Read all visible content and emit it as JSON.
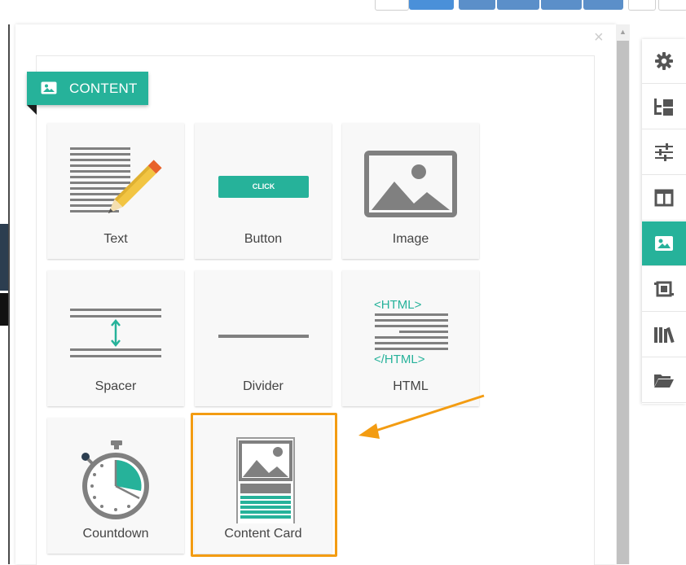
{
  "panel": {
    "header_label": "CONTENT",
    "close_symbol": "×"
  },
  "tiles": [
    {
      "label": "Text",
      "icon": "text-pencil-icon"
    },
    {
      "label": "Button",
      "icon": "button-icon",
      "sample_text": "CLICK"
    },
    {
      "label": "Image",
      "icon": "image-icon"
    },
    {
      "label": "Spacer",
      "icon": "spacer-icon"
    },
    {
      "label": "Divider",
      "icon": "divider-icon"
    },
    {
      "label": "HTML",
      "icon": "html-icon",
      "open_tag": "<HTML>",
      "close_tag": "</HTML>"
    },
    {
      "label": "Countdown",
      "icon": "stopwatch-icon"
    },
    {
      "label": "Content Card",
      "icon": "content-card-icon",
      "highlighted": true
    }
  ],
  "sidebar": {
    "items": [
      {
        "icon": "gear-icon",
        "active": false
      },
      {
        "icon": "tree-structure-icon",
        "active": false
      },
      {
        "icon": "sliders-icon",
        "active": false
      },
      {
        "icon": "columns-icon",
        "active": false
      },
      {
        "icon": "image-icon",
        "active": true
      },
      {
        "icon": "crop-frame-icon",
        "active": false
      },
      {
        "icon": "library-books-icon",
        "active": false
      },
      {
        "icon": "folder-open-icon",
        "active": false
      }
    ]
  },
  "colors": {
    "accent": "#26b29a",
    "highlight": "#f39c12",
    "icon_gray": "#808080",
    "toolbar_blue": "#4a90d9"
  }
}
